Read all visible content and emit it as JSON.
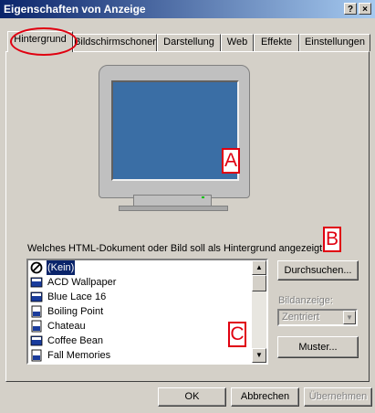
{
  "window": {
    "title": "Eigenschaften von Anzeige",
    "help_button": "?",
    "close_button": "×"
  },
  "tabs": [
    {
      "label": "Hintergrund",
      "active": true
    },
    {
      "label": "Bildschirmschoner",
      "active": false
    },
    {
      "label": "Darstellung",
      "active": false
    },
    {
      "label": "Web",
      "active": false
    },
    {
      "label": "Effekte",
      "active": false
    },
    {
      "label": "Einstellungen",
      "active": false
    }
  ],
  "preview": {
    "screen_color": "#3a6ea5",
    "markers": {
      "a": "A",
      "b": "B",
      "c": "C"
    }
  },
  "wallpaper": {
    "prompt": "Welches HTML-Dokument oder Bild soll als Hintergrund angezeigt wer",
    "items": [
      {
        "label": "(Kein)",
        "icon": "none-icon",
        "selected": true
      },
      {
        "label": "ACD Wallpaper",
        "icon": "bmp-icon",
        "selected": false
      },
      {
        "label": "Blue Lace 16",
        "icon": "bmp-icon",
        "selected": false
      },
      {
        "label": "Boiling Point",
        "icon": "image-file-icon",
        "selected": false
      },
      {
        "label": "Chateau",
        "icon": "image-file-icon",
        "selected": false
      },
      {
        "label": "Coffee Bean",
        "icon": "bmp-icon",
        "selected": false
      },
      {
        "label": "Fall Memories",
        "icon": "image-file-icon",
        "selected": false
      }
    ],
    "browse_button": "Durchsuchen...",
    "display_label": "Bildanzeige:",
    "display_value": "Zentriert",
    "pattern_button": "Muster..."
  },
  "footer": {
    "ok": "OK",
    "cancel": "Abbrechen",
    "apply": "Übernehmen"
  },
  "colors": {
    "titlebar_start": "#0a246a",
    "titlebar_end": "#a6caf0",
    "dialog_face": "#d4d0c8",
    "annotation_red": "#e00010",
    "selection": "#0a246a"
  }
}
